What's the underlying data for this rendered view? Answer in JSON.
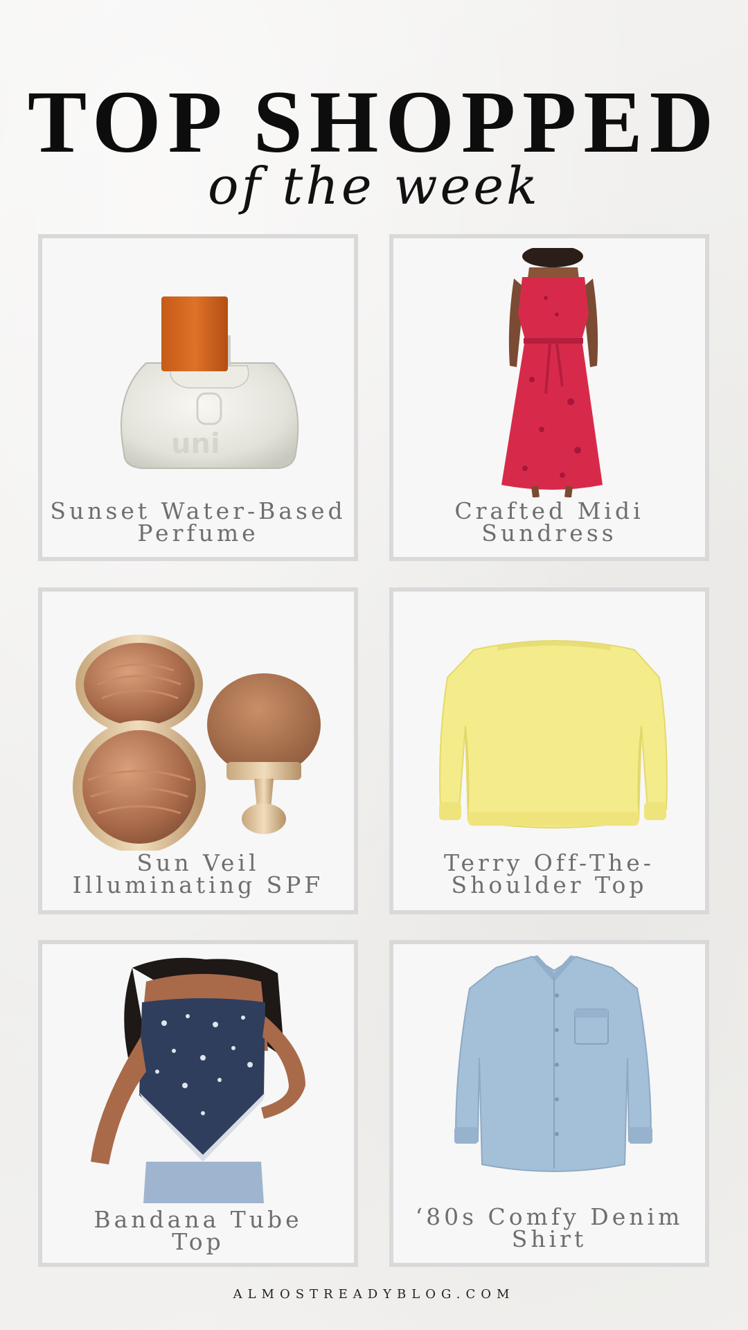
{
  "header": {
    "title": "TOP SHOPPED",
    "subtitle": "of the week"
  },
  "products": [
    {
      "label": "Sunset Water-Based\nPerfume",
      "image": "perfume-bottle"
    },
    {
      "label": "Crafted Midi\nSundress",
      "image": "red-sundress"
    },
    {
      "label": "Sun Veil\nIlluminating SPF",
      "image": "bronzer-compact-and-brush"
    },
    {
      "label": "Terry Off-The-\nShoulder Top",
      "image": "yellow-sweatshirt"
    },
    {
      "label": "Bandana Tube\nTop",
      "image": "bandana-tube-top"
    },
    {
      "label": "‘80s Comfy Denim\nShirt",
      "image": "denim-shirt"
    }
  ],
  "footer": {
    "site": "ALMOSTREADYBLOG.COM"
  },
  "colors": {
    "background": "#f1f0ef",
    "card_border": "#d9d9d9",
    "card_fill": "#f7f7f7",
    "title": "#0d0d0d",
    "label": "#6e6e6e"
  }
}
